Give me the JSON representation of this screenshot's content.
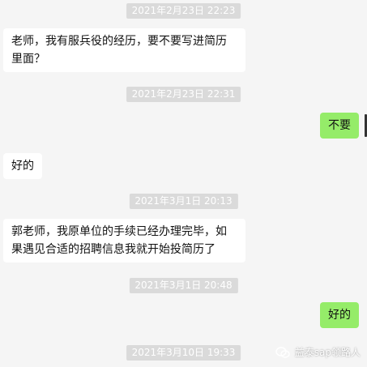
{
  "messages": [
    {
      "kind": "time",
      "text": "2021年2月23日 22:23"
    },
    {
      "kind": "in",
      "text": "老师，我有服兵役的经历，要不要写进简历里面？"
    },
    {
      "kind": "time",
      "text": "2021年2月23日 22:31"
    },
    {
      "kind": "out",
      "text": "不要"
    },
    {
      "kind": "in",
      "text": "好的"
    },
    {
      "kind": "time",
      "text": "2021年3月1日 20:13"
    },
    {
      "kind": "in",
      "text": "郭老师，我原单位的手续已经办理完毕，如果遇见合适的招聘信息我就开始投简历了"
    },
    {
      "kind": "time",
      "text": "2021年3月1日 20:48"
    },
    {
      "kind": "out",
      "text": "好的"
    },
    {
      "kind": "time",
      "text": "2021年3月10日 19:33"
    }
  ],
  "watermark": {
    "text": "益泰sap领路人",
    "icon": "wechat-icon"
  },
  "colors": {
    "background": "#f5f5f5",
    "incoming_bubble": "#ffffff",
    "outgoing_bubble": "#95ec69",
    "timestamp_bg": "#dadada"
  }
}
